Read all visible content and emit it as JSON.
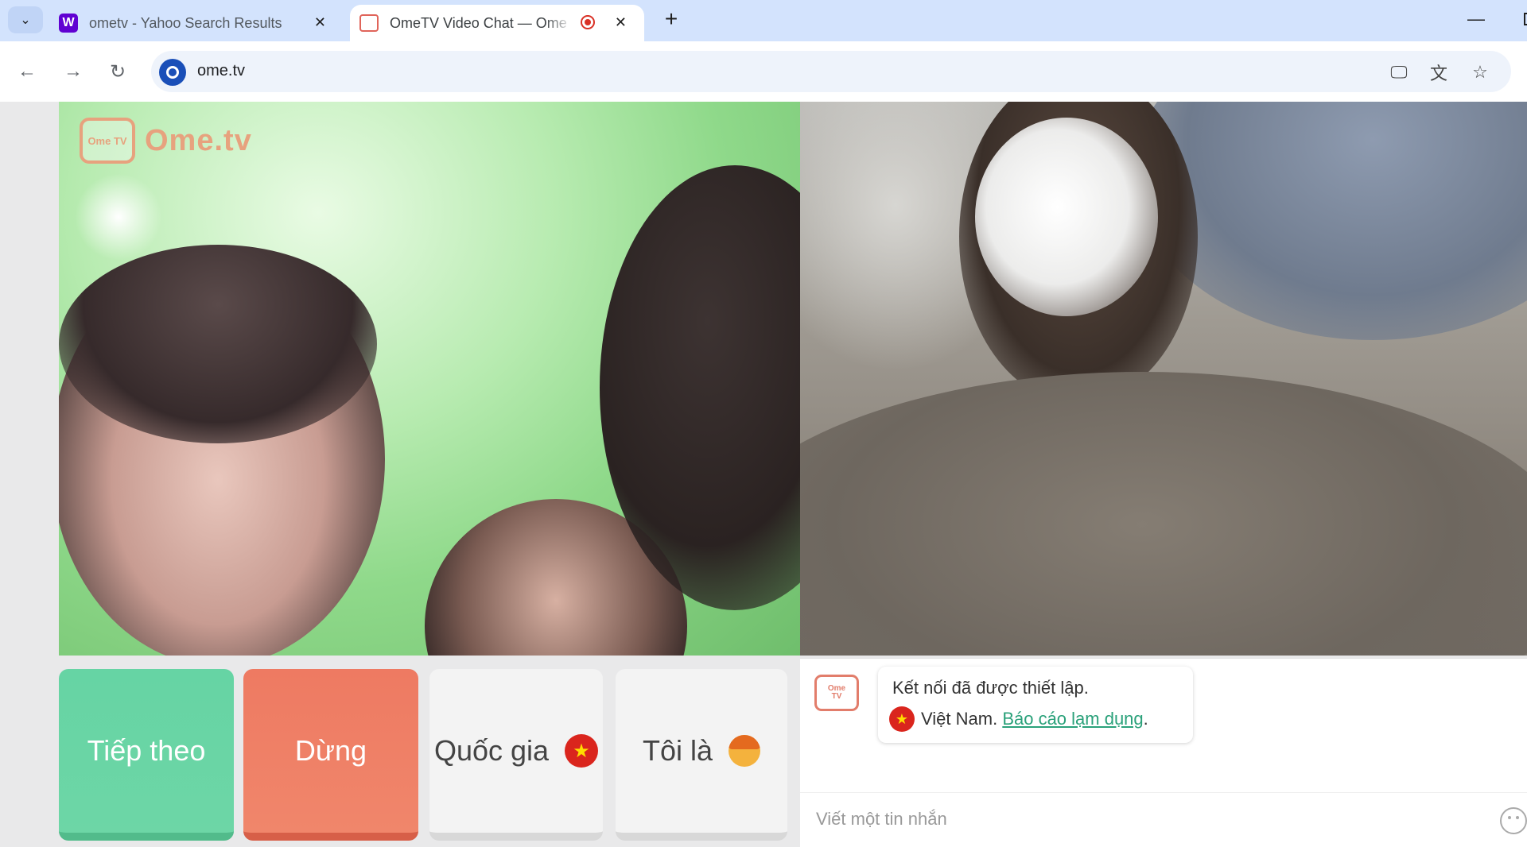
{
  "browser": {
    "tabs": [
      {
        "title": "ometv - Yahoo Search Results",
        "favicon": "yahoo-icon",
        "active": false
      },
      {
        "title": "OmeTV Video Chat — Ome",
        "favicon": "ometv-icon",
        "active": true,
        "recording": true
      }
    ],
    "url": "ome.tv"
  },
  "page": {
    "logo_text": "Ome.tv",
    "logo_badge": "Ome TV",
    "buttons": {
      "next": "Tiếp theo",
      "stop": "Dừng",
      "country": "Quốc gia",
      "gender": "Tôi là"
    },
    "colors": {
      "next": "#66d4a4",
      "stop": "#ee7a62",
      "link": "#2aa17a"
    }
  },
  "chat": {
    "system_message": "Kết nối đã được thiết lập.",
    "country": "Việt Nam.",
    "report_link": "Báo cáo lạm dụng",
    "report_suffix": ".",
    "input_placeholder": "Viết một tin nhắn"
  }
}
